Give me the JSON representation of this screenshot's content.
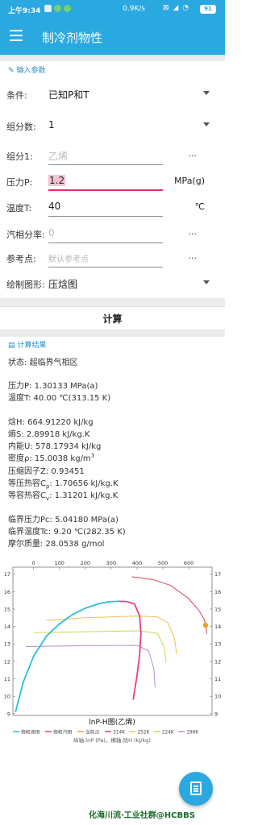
{
  "status_bar": {
    "time": "上午9:34",
    "speed": "0.9K/s",
    "battery": "91"
  },
  "app_bar": {
    "title": "制冷剂物性"
  },
  "input_section": {
    "header": "输入参数",
    "rows": [
      {
        "label": "条件:",
        "value": "已知P和T",
        "kind": "select"
      },
      {
        "label": "组分数:",
        "value": "1",
        "kind": "select"
      },
      {
        "label": "组分1:",
        "placeholder": "乙烯",
        "action": "...",
        "kind": "picker"
      },
      {
        "label": "压力P:",
        "value": "1.2",
        "unit": "MPa(g)",
        "kind": "input"
      },
      {
        "label": "温度T:",
        "value": "40",
        "unit": "℃",
        "kind": "input"
      },
      {
        "label": "汽相分率:",
        "placeholder": "0",
        "action": "...",
        "kind": "picker"
      },
      {
        "label": "参考点:",
        "placeholder": "默认参考点",
        "action": "...",
        "kind": "picker"
      },
      {
        "label": "绘制图形:",
        "value": "压焓图",
        "kind": "select"
      }
    ]
  },
  "calculate_button": "计算",
  "results": {
    "header": "计算结果",
    "state": "状态: 超临界气相区",
    "pressure": "压力P: 1.30133 MPa(a)",
    "temperature": "温度T: 40.00 ℃(313.15 K)",
    "enthalpy": "焓H: 664.91220 kJ/kg",
    "entropy": "熵S: 2.89918 kJ/kg.K",
    "internal_energy": "内能U: 578.17934 kJ/kg",
    "density_prefix": "密度ρ: 15.0038 kg/m",
    "density_sup": "3",
    "compressibility": "压缩因子Z: 0.93451",
    "cp_prefix": "等压热容C",
    "cp_sub": "p",
    "cp_value": ": 1.70656 kJ/kg.K",
    "cv_prefix": "等容热容C",
    "cv_sub": "v",
    "cv_value": ": 1.31201 kJ/kg.K",
    "critical_pressure": "临界压力Pc: 5.04180 MPa(a)",
    "critical_temperature": "临界温度Tc: 9.20 ℃(282.35 K)",
    "molar_mass": "摩尔质量: 28.0538 g/mol"
  },
  "chart_data": {
    "type": "line",
    "title": "lnP-H图(乙烯)",
    "subtitle": "纵轴:lnP (Pa)，横轴:焓H (kJ/kg)",
    "x_ticks": [
      "0",
      "100",
      "200",
      "300",
      "400",
      "500",
      "600"
    ],
    "y_ticks": [
      "17",
      "16",
      "15",
      "14",
      "13",
      "12",
      "11",
      "10",
      "9"
    ],
    "xlim": [
      -80,
      690
    ],
    "ylim": [
      8.9,
      17.4
    ],
    "colors": {
      "liquid": "#27c0dd",
      "vapor": "#e63e86",
      "point": "#f0a020",
      "t314": "#d94458",
      "t252": "#f2c045",
      "t224": "#c9d84a",
      "t196": "#b890c8"
    },
    "series": [
      {
        "name": "饱和液相",
        "key": "liquid",
        "points": [
          [
            -70,
            9.1
          ],
          [
            -40,
            10.8
          ],
          [
            0,
            12.3
          ],
          [
            50,
            13.45
          ],
          [
            100,
            14.15
          ],
          [
            150,
            14.68
          ],
          [
            200,
            15.05
          ],
          [
            250,
            15.3
          ],
          [
            290,
            15.42
          ],
          [
            330,
            15.44
          ]
        ]
      },
      {
        "name": "饱和汽相",
        "key": "vapor",
        "points": [
          [
            330,
            15.44
          ],
          [
            360,
            15.43
          ],
          [
            390,
            15.3
          ],
          [
            410,
            14.6
          ],
          [
            415,
            13.6
          ],
          [
            410,
            12.4
          ],
          [
            400,
            11.2
          ],
          [
            385,
            9.8
          ]
        ]
      },
      {
        "name": "当前点",
        "key": "point",
        "points": [
          [
            665,
            14.07
          ]
        ]
      },
      {
        "name": "314K",
        "key": "t314",
        "points": [
          [
            380,
            16.85
          ],
          [
            460,
            16.7
          ],
          [
            530,
            16.35
          ],
          [
            600,
            15.6
          ],
          [
            640,
            14.9
          ],
          [
            660,
            14.4
          ],
          [
            665,
            14.07
          ],
          [
            670,
            13.6
          ]
        ]
      },
      {
        "name": "252K",
        "key": "t252",
        "points": [
          [
            50,
            14.35
          ],
          [
            200,
            14.5
          ],
          [
            400,
            14.6
          ],
          [
            480,
            14.55
          ],
          [
            520,
            14.2
          ],
          [
            545,
            13.3
          ],
          [
            553,
            12.4
          ]
        ]
      },
      {
        "name": "224K",
        "key": "t224",
        "points": [
          [
            0,
            13.65
          ],
          [
            200,
            13.7
          ],
          [
            410,
            13.75
          ],
          [
            480,
            13.6
          ],
          [
            505,
            12.8
          ],
          [
            513,
            11.9
          ]
        ]
      },
      {
        "name": "196K",
        "key": "t196",
        "points": [
          [
            -30,
            12.85
          ],
          [
            200,
            12.9
          ],
          [
            400,
            12.92
          ],
          [
            445,
            12.6
          ],
          [
            465,
            11.6
          ],
          [
            470,
            10.5
          ]
        ]
      }
    ]
  },
  "watermark": "化海川流·工业社群@HCBBS"
}
